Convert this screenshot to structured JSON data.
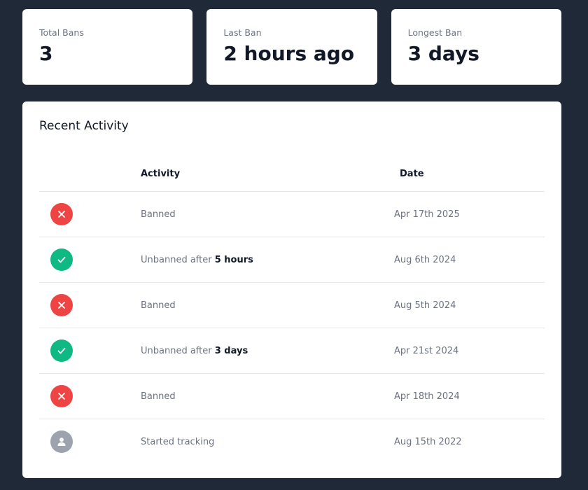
{
  "stats": [
    {
      "label": "Total Bans",
      "value": "3"
    },
    {
      "label": "Last Ban",
      "value": "2 hours ago"
    },
    {
      "label": "Longest Ban",
      "value": "3 days"
    }
  ],
  "activity": {
    "title": "Recent Activity",
    "columns": {
      "activity": "Activity",
      "date": "Date"
    },
    "rows": [
      {
        "icon": "x-icon",
        "color": "#ef4444",
        "text": "Banned",
        "emphasis": "",
        "date": "Apr 17th 2025"
      },
      {
        "icon": "check-icon",
        "color": "#10b981",
        "text": "Unbanned after ",
        "emphasis": "5 hours",
        "date": "Aug 6th 2024"
      },
      {
        "icon": "x-icon",
        "color": "#ef4444",
        "text": "Banned",
        "emphasis": "",
        "date": "Aug 5th 2024"
      },
      {
        "icon": "check-icon",
        "color": "#10b981",
        "text": "Unbanned after ",
        "emphasis": "3 days",
        "date": "Apr 21st 2024"
      },
      {
        "icon": "x-icon",
        "color": "#ef4444",
        "text": "Banned",
        "emphasis": "",
        "date": "Apr 18th 2024"
      },
      {
        "icon": "user-icon",
        "color": "#9ca3af",
        "text": "Started tracking",
        "emphasis": "",
        "date": "Aug 15th 2022"
      }
    ]
  }
}
